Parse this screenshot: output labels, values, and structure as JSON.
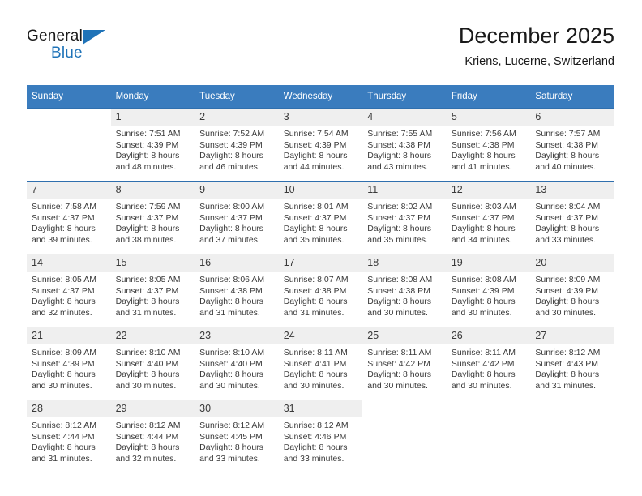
{
  "brand": {
    "name_part1": "General",
    "name_part2": "Blue",
    "triangle_color": "#1f73b8"
  },
  "header": {
    "title": "December 2025",
    "subtitle": "Kriens, Lucerne, Switzerland"
  },
  "theme": {
    "header_bg": "#3a7cbe",
    "header_text": "#ffffff",
    "daynum_bg": "#efefef",
    "rule_color": "#2f6fae",
    "body_text": "#3a3a3a"
  },
  "calendar": {
    "weekday_headers": [
      "Sunday",
      "Monday",
      "Tuesday",
      "Wednesday",
      "Thursday",
      "Friday",
      "Saturday"
    ],
    "weeks": [
      [
        {
          "day": "",
          "sunrise": "",
          "sunset": "",
          "daylight_line1": "",
          "daylight_line2": "",
          "empty": true
        },
        {
          "day": "1",
          "sunrise": "Sunrise: 7:51 AM",
          "sunset": "Sunset: 4:39 PM",
          "daylight_line1": "Daylight: 8 hours",
          "daylight_line2": "and 48 minutes."
        },
        {
          "day": "2",
          "sunrise": "Sunrise: 7:52 AM",
          "sunset": "Sunset: 4:39 PM",
          "daylight_line1": "Daylight: 8 hours",
          "daylight_line2": "and 46 minutes."
        },
        {
          "day": "3",
          "sunrise": "Sunrise: 7:54 AM",
          "sunset": "Sunset: 4:39 PM",
          "daylight_line1": "Daylight: 8 hours",
          "daylight_line2": "and 44 minutes."
        },
        {
          "day": "4",
          "sunrise": "Sunrise: 7:55 AM",
          "sunset": "Sunset: 4:38 PM",
          "daylight_line1": "Daylight: 8 hours",
          "daylight_line2": "and 43 minutes."
        },
        {
          "day": "5",
          "sunrise": "Sunrise: 7:56 AM",
          "sunset": "Sunset: 4:38 PM",
          "daylight_line1": "Daylight: 8 hours",
          "daylight_line2": "and 41 minutes."
        },
        {
          "day": "6",
          "sunrise": "Sunrise: 7:57 AM",
          "sunset": "Sunset: 4:38 PM",
          "daylight_line1": "Daylight: 8 hours",
          "daylight_line2": "and 40 minutes."
        }
      ],
      [
        {
          "day": "7",
          "sunrise": "Sunrise: 7:58 AM",
          "sunset": "Sunset: 4:37 PM",
          "daylight_line1": "Daylight: 8 hours",
          "daylight_line2": "and 39 minutes."
        },
        {
          "day": "8",
          "sunrise": "Sunrise: 7:59 AM",
          "sunset": "Sunset: 4:37 PM",
          "daylight_line1": "Daylight: 8 hours",
          "daylight_line2": "and 38 minutes."
        },
        {
          "day": "9",
          "sunrise": "Sunrise: 8:00 AM",
          "sunset": "Sunset: 4:37 PM",
          "daylight_line1": "Daylight: 8 hours",
          "daylight_line2": "and 37 minutes."
        },
        {
          "day": "10",
          "sunrise": "Sunrise: 8:01 AM",
          "sunset": "Sunset: 4:37 PM",
          "daylight_line1": "Daylight: 8 hours",
          "daylight_line2": "and 35 minutes."
        },
        {
          "day": "11",
          "sunrise": "Sunrise: 8:02 AM",
          "sunset": "Sunset: 4:37 PM",
          "daylight_line1": "Daylight: 8 hours",
          "daylight_line2": "and 35 minutes."
        },
        {
          "day": "12",
          "sunrise": "Sunrise: 8:03 AM",
          "sunset": "Sunset: 4:37 PM",
          "daylight_line1": "Daylight: 8 hours",
          "daylight_line2": "and 34 minutes."
        },
        {
          "day": "13",
          "sunrise": "Sunrise: 8:04 AM",
          "sunset": "Sunset: 4:37 PM",
          "daylight_line1": "Daylight: 8 hours",
          "daylight_line2": "and 33 minutes."
        }
      ],
      [
        {
          "day": "14",
          "sunrise": "Sunrise: 8:05 AM",
          "sunset": "Sunset: 4:37 PM",
          "daylight_line1": "Daylight: 8 hours",
          "daylight_line2": "and 32 minutes."
        },
        {
          "day": "15",
          "sunrise": "Sunrise: 8:05 AM",
          "sunset": "Sunset: 4:37 PM",
          "daylight_line1": "Daylight: 8 hours",
          "daylight_line2": "and 31 minutes."
        },
        {
          "day": "16",
          "sunrise": "Sunrise: 8:06 AM",
          "sunset": "Sunset: 4:38 PM",
          "daylight_line1": "Daylight: 8 hours",
          "daylight_line2": "and 31 minutes."
        },
        {
          "day": "17",
          "sunrise": "Sunrise: 8:07 AM",
          "sunset": "Sunset: 4:38 PM",
          "daylight_line1": "Daylight: 8 hours",
          "daylight_line2": "and 31 minutes."
        },
        {
          "day": "18",
          "sunrise": "Sunrise: 8:08 AM",
          "sunset": "Sunset: 4:38 PM",
          "daylight_line1": "Daylight: 8 hours",
          "daylight_line2": "and 30 minutes."
        },
        {
          "day": "19",
          "sunrise": "Sunrise: 8:08 AM",
          "sunset": "Sunset: 4:39 PM",
          "daylight_line1": "Daylight: 8 hours",
          "daylight_line2": "and 30 minutes."
        },
        {
          "day": "20",
          "sunrise": "Sunrise: 8:09 AM",
          "sunset": "Sunset: 4:39 PM",
          "daylight_line1": "Daylight: 8 hours",
          "daylight_line2": "and 30 minutes."
        }
      ],
      [
        {
          "day": "21",
          "sunrise": "Sunrise: 8:09 AM",
          "sunset": "Sunset: 4:39 PM",
          "daylight_line1": "Daylight: 8 hours",
          "daylight_line2": "and 30 minutes."
        },
        {
          "day": "22",
          "sunrise": "Sunrise: 8:10 AM",
          "sunset": "Sunset: 4:40 PM",
          "daylight_line1": "Daylight: 8 hours",
          "daylight_line2": "and 30 minutes."
        },
        {
          "day": "23",
          "sunrise": "Sunrise: 8:10 AM",
          "sunset": "Sunset: 4:40 PM",
          "daylight_line1": "Daylight: 8 hours",
          "daylight_line2": "and 30 minutes."
        },
        {
          "day": "24",
          "sunrise": "Sunrise: 8:11 AM",
          "sunset": "Sunset: 4:41 PM",
          "daylight_line1": "Daylight: 8 hours",
          "daylight_line2": "and 30 minutes."
        },
        {
          "day": "25",
          "sunrise": "Sunrise: 8:11 AM",
          "sunset": "Sunset: 4:42 PM",
          "daylight_line1": "Daylight: 8 hours",
          "daylight_line2": "and 30 minutes."
        },
        {
          "day": "26",
          "sunrise": "Sunrise: 8:11 AM",
          "sunset": "Sunset: 4:42 PM",
          "daylight_line1": "Daylight: 8 hours",
          "daylight_line2": "and 30 minutes."
        },
        {
          "day": "27",
          "sunrise": "Sunrise: 8:12 AM",
          "sunset": "Sunset: 4:43 PM",
          "daylight_line1": "Daylight: 8 hours",
          "daylight_line2": "and 31 minutes."
        }
      ],
      [
        {
          "day": "28",
          "sunrise": "Sunrise: 8:12 AM",
          "sunset": "Sunset: 4:44 PM",
          "daylight_line1": "Daylight: 8 hours",
          "daylight_line2": "and 31 minutes."
        },
        {
          "day": "29",
          "sunrise": "Sunrise: 8:12 AM",
          "sunset": "Sunset: 4:44 PM",
          "daylight_line1": "Daylight: 8 hours",
          "daylight_line2": "and 32 minutes."
        },
        {
          "day": "30",
          "sunrise": "Sunrise: 8:12 AM",
          "sunset": "Sunset: 4:45 PM",
          "daylight_line1": "Daylight: 8 hours",
          "daylight_line2": "and 33 minutes."
        },
        {
          "day": "31",
          "sunrise": "Sunrise: 8:12 AM",
          "sunset": "Sunset: 4:46 PM",
          "daylight_line1": "Daylight: 8 hours",
          "daylight_line2": "and 33 minutes."
        },
        {
          "day": "",
          "sunrise": "",
          "sunset": "",
          "daylight_line1": "",
          "daylight_line2": "",
          "empty": true
        },
        {
          "day": "",
          "sunrise": "",
          "sunset": "",
          "daylight_line1": "",
          "daylight_line2": "",
          "empty": true
        },
        {
          "day": "",
          "sunrise": "",
          "sunset": "",
          "daylight_line1": "",
          "daylight_line2": "",
          "empty": true
        }
      ]
    ]
  }
}
